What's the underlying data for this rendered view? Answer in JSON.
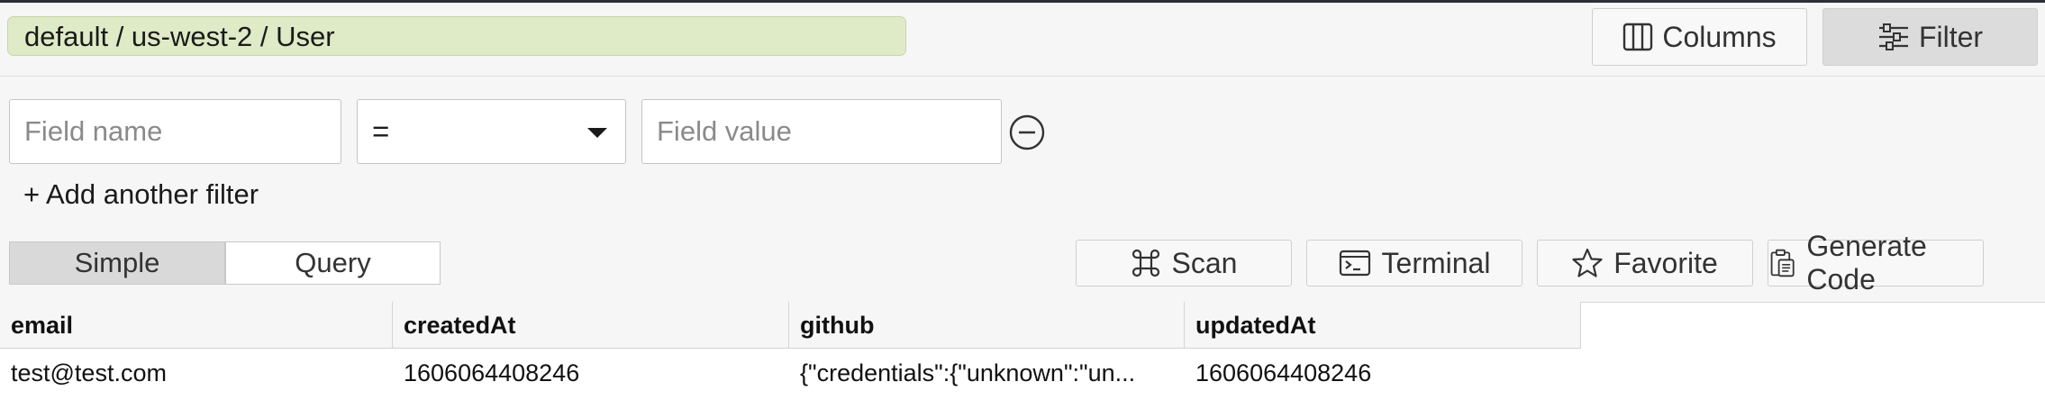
{
  "breadcrumb": "default / us-west-2 / User",
  "toolbar": {
    "columns_label": "Columns",
    "filter_label": "Filter"
  },
  "filter": {
    "field_name_placeholder": "Field name",
    "operator": "=",
    "field_value_placeholder": "Field value",
    "add_label": "+ Add another filter"
  },
  "mode_tabs": [
    {
      "label": "Simple",
      "active": true
    },
    {
      "label": "Query",
      "active": false
    }
  ],
  "actions": {
    "scan_label": "Scan",
    "terminal_label": "Terminal",
    "favorite_label": "Favorite",
    "generate_label": "Generate Code"
  },
  "table": {
    "columns": [
      "email",
      "createdAt",
      "github",
      "updatedAt"
    ],
    "rows": [
      [
        "test@test.com",
        "1606064408246",
        "{\"credentials\":{\"unknown\":\"un...",
        "1606064408246"
      ]
    ]
  },
  "colors": {
    "breadcrumb_bg": "#dfeac6",
    "panel_bg": "#f6f6f6",
    "active_bg": "#d9d9d9"
  }
}
